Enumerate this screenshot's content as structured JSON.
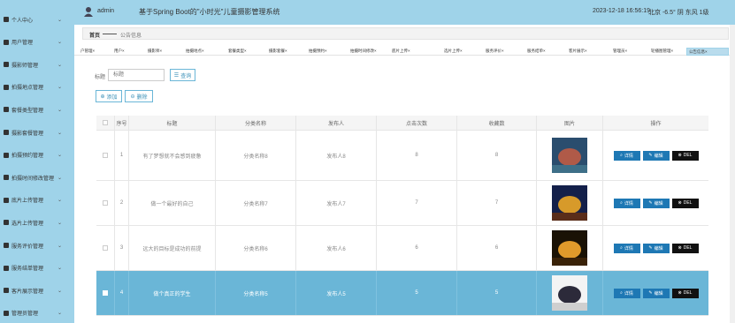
{
  "header": {
    "username": "admin",
    "app_title": "基于Spring Boot的\"小时光\"儿童摄影管理系统",
    "datetime": "2023-12-18 16:56:19",
    "weather": "北京 -6.5° 阴 东风 1级"
  },
  "sidebar": {
    "items": [
      {
        "label": "个人中心",
        "icon": "person-icon"
      },
      {
        "label": "用户管理",
        "icon": "home-icon"
      },
      {
        "label": "摄影师管理",
        "icon": "monitor-icon"
      },
      {
        "label": "拍摄地点管理",
        "icon": "grid-icon"
      },
      {
        "label": "套餐类型管理",
        "icon": "grid-icon"
      },
      {
        "label": "摄影套餐管理",
        "icon": "grid-icon"
      },
      {
        "label": "拍摄预约管理",
        "icon": "grid-icon"
      },
      {
        "label": "拍摄时间修改管理",
        "icon": "grid-icon"
      },
      {
        "label": "底片上传管理",
        "icon": "grid-icon"
      },
      {
        "label": "选片上传管理",
        "icon": "grid-icon"
      },
      {
        "label": "服务评价管理",
        "icon": "grid-icon"
      },
      {
        "label": "服务结单管理",
        "icon": "person-icon"
      },
      {
        "label": "客片展示管理",
        "icon": "gear-icon"
      },
      {
        "label": "管理员管理",
        "icon": "monitor-icon"
      }
    ]
  },
  "breadcrumb": {
    "home": "首页",
    "current": "公告信息"
  },
  "tabs": [
    {
      "label": "户管理",
      "active": false
    },
    {
      "label": "用户",
      "active": false
    },
    {
      "label": "摄影师",
      "active": false
    },
    {
      "label": "拍摄地点",
      "active": false
    },
    {
      "label": "套餐类型",
      "active": false
    },
    {
      "label": "摄影套餐",
      "active": false
    },
    {
      "label": "拍摄预约",
      "active": false
    },
    {
      "label": "拍摄时间修改",
      "active": false
    },
    {
      "label": "底片上传",
      "active": false
    },
    {
      "label": "选片上传",
      "active": false
    },
    {
      "label": "服务评价",
      "active": false
    },
    {
      "label": "服务结单",
      "active": false
    },
    {
      "label": "客片展示",
      "active": false
    },
    {
      "label": "管理员",
      "active": false
    },
    {
      "label": "轮播图管理",
      "active": false
    },
    {
      "label": "公告信息",
      "active": true
    }
  ],
  "search": {
    "label": "标题",
    "placeholder": "标题",
    "button": "查询"
  },
  "actions": {
    "add": "添加",
    "delete": "删除"
  },
  "table": {
    "headers": {
      "index": "序号",
      "title": "标题",
      "category": "分类名称",
      "publisher": "发布人",
      "clicks": "点击次数",
      "favorites": "收藏数",
      "image": "图片",
      "ops": "操作"
    },
    "rows": [
      {
        "index": "1",
        "title": "有了梦想就不会感到疲惫",
        "category": "分类名称8",
        "publisher": "发布人8",
        "clicks": "8",
        "favorites": "8",
        "selected": false,
        "image_colors": [
          "#2a4d6e",
          "#b05a48",
          "#3e6f88"
        ]
      },
      {
        "index": "2",
        "title": "做一个最好的自己",
        "category": "分类名称7",
        "publisher": "发布人7",
        "clicks": "7",
        "favorites": "7",
        "selected": false,
        "image_colors": [
          "#14204a",
          "#d79a2a",
          "#5a2d1a"
        ]
      },
      {
        "index": "3",
        "title": "远大的目标是成功的前提",
        "category": "分类名称6",
        "publisher": "发布人6",
        "clicks": "6",
        "favorites": "6",
        "selected": false,
        "image_colors": [
          "#1a1205",
          "#e09a2b",
          "#3a2208"
        ]
      },
      {
        "index": "4",
        "title": "做个真正的学生",
        "category": "分类名称5",
        "publisher": "发布人5",
        "clicks": "5",
        "favorites": "5",
        "selected": true,
        "image_colors": [
          "#f4f4f4",
          "#2c2a3a",
          "#cfcfcf"
        ]
      }
    ],
    "row_buttons": {
      "detail": "详情",
      "edit": "编辑",
      "del": "DEL"
    }
  },
  "colors": {
    "accent": "#9fd3e9",
    "selected_row": "#6ab6d7",
    "primary_button": "#1e78b4",
    "delete_button": "#111111"
  }
}
